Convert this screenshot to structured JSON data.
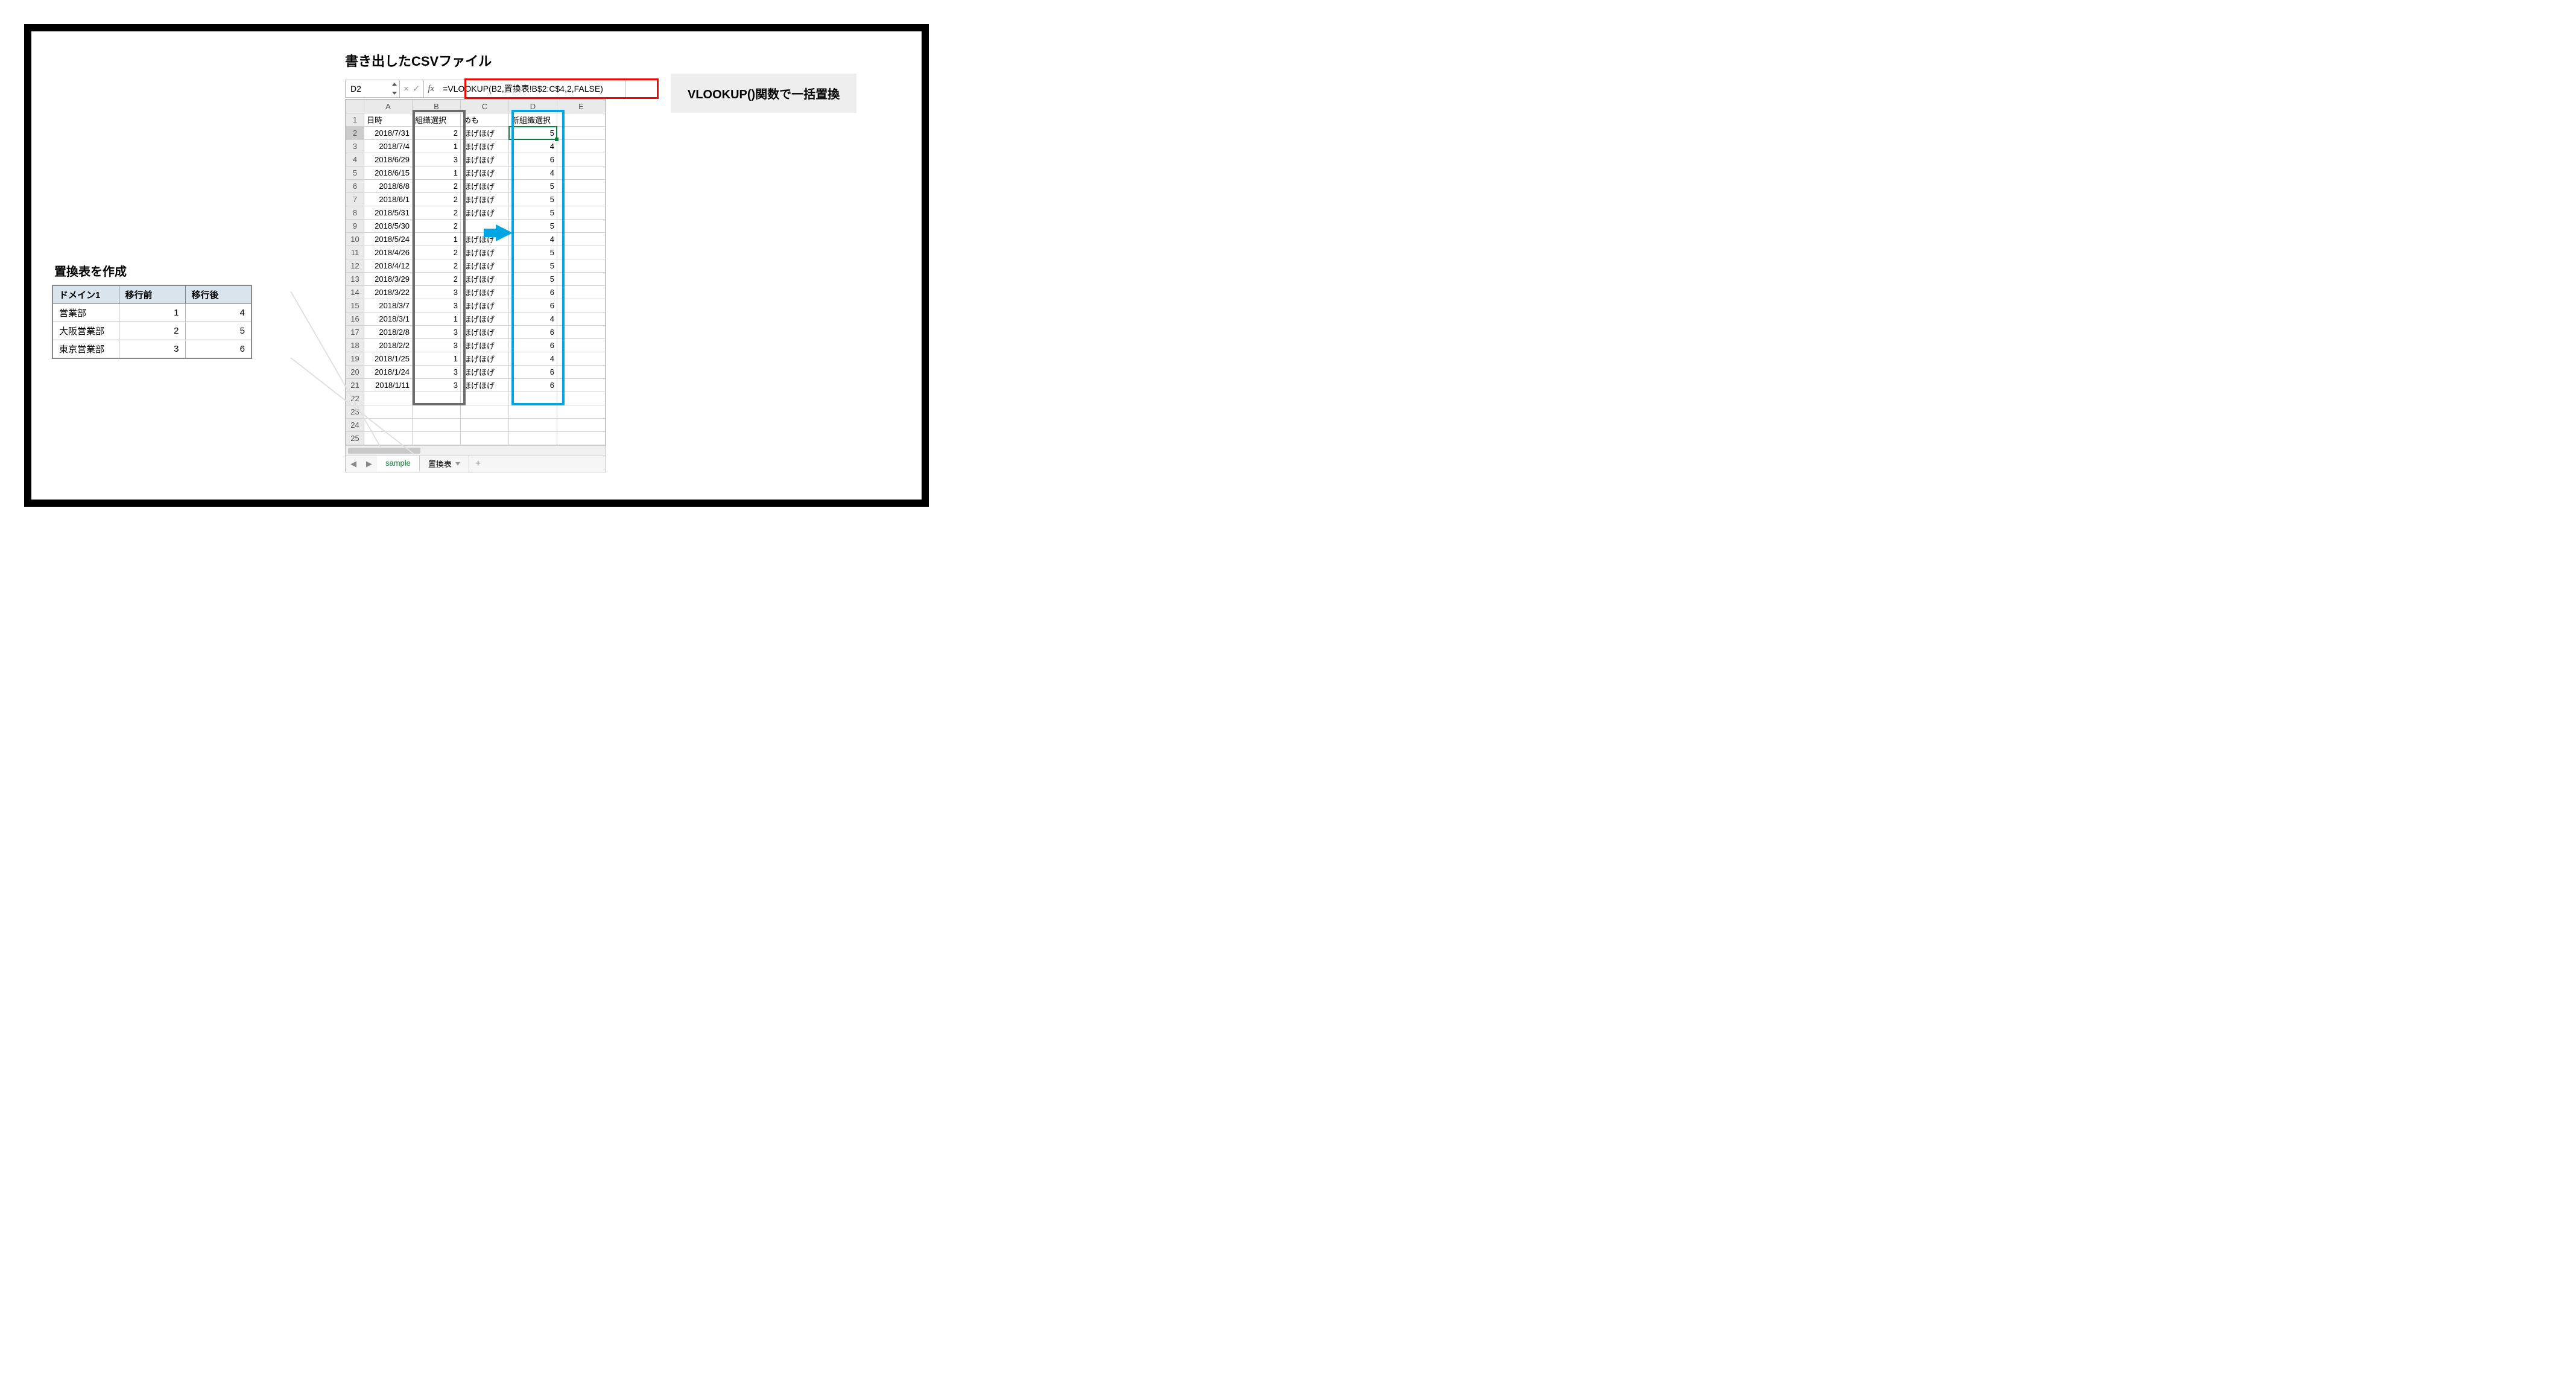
{
  "csv_title": "書き出したCSVファイル",
  "callout": "VLOOKUP()関数で一括置換",
  "map_title": "置換表を作成",
  "formula_bar": {
    "cell_ref": "D2",
    "cancel": "×",
    "confirm": "✓",
    "fx": "fx",
    "formula": "=VLOOKUP(B2,置換表!B$2:C$4,2,FALSE)"
  },
  "columns": [
    "A",
    "B",
    "C",
    "D",
    "E"
  ],
  "headers": {
    "A": "日時",
    "B": "組織選択",
    "C": "めも",
    "D": "新組織選択",
    "E": ""
  },
  "rows": [
    {
      "n": 2,
      "A": "2018/7/31",
      "B": "2",
      "C": "ほげほげ",
      "D": "5"
    },
    {
      "n": 3,
      "A": "2018/7/4",
      "B": "1",
      "C": "ほげほげ",
      "D": "4"
    },
    {
      "n": 4,
      "A": "2018/6/29",
      "B": "3",
      "C": "ほげほげ",
      "D": "6"
    },
    {
      "n": 5,
      "A": "2018/6/15",
      "B": "1",
      "C": "ほげほげ",
      "D": "4"
    },
    {
      "n": 6,
      "A": "2018/6/8",
      "B": "2",
      "C": "ほげほげ",
      "D": "5"
    },
    {
      "n": 7,
      "A": "2018/6/1",
      "B": "2",
      "C": "ほげほげ",
      "D": "5"
    },
    {
      "n": 8,
      "A": "2018/5/31",
      "B": "2",
      "C": "ほげほげ",
      "D": "5"
    },
    {
      "n": 9,
      "A": "2018/5/30",
      "B": "2",
      "C": "",
      "D": "5"
    },
    {
      "n": 10,
      "A": "2018/5/24",
      "B": "1",
      "C": "ほげほげ",
      "D": "4"
    },
    {
      "n": 11,
      "A": "2018/4/26",
      "B": "2",
      "C": "ほげほげ",
      "D": "5"
    },
    {
      "n": 12,
      "A": "2018/4/12",
      "B": "2",
      "C": "ほげほげ",
      "D": "5"
    },
    {
      "n": 13,
      "A": "2018/3/29",
      "B": "2",
      "C": "ほげほげ",
      "D": "5"
    },
    {
      "n": 14,
      "A": "2018/3/22",
      "B": "3",
      "C": "ほげほげ",
      "D": "6"
    },
    {
      "n": 15,
      "A": "2018/3/7",
      "B": "3",
      "C": "ほげほげ",
      "D": "6"
    },
    {
      "n": 16,
      "A": "2018/3/1",
      "B": "1",
      "C": "ほげほげ",
      "D": "4"
    },
    {
      "n": 17,
      "A": "2018/2/8",
      "B": "3",
      "C": "ほげほげ",
      "D": "6"
    },
    {
      "n": 18,
      "A": "2018/2/2",
      "B": "3",
      "C": "ほげほげ",
      "D": "6"
    },
    {
      "n": 19,
      "A": "2018/1/25",
      "B": "1",
      "C": "ほげほげ",
      "D": "4"
    },
    {
      "n": 20,
      "A": "2018/1/24",
      "B": "3",
      "C": "ほげほげ",
      "D": "6"
    },
    {
      "n": 21,
      "A": "2018/1/11",
      "B": "3",
      "C": "ほげほげ",
      "D": "6"
    }
  ],
  "empty_rows": [
    22,
    23,
    24,
    25
  ],
  "tabs": {
    "prev": "◀",
    "next": "▶",
    "active": "sample",
    "other": "置換表",
    "add": "+"
  },
  "map_headers": [
    "ドメイン1",
    "移行前",
    "移行後"
  ],
  "map_rows": [
    {
      "name": "営業部",
      "before": "1",
      "after": "4"
    },
    {
      "name": "大阪営業部",
      "before": "2",
      "after": "5"
    },
    {
      "name": "東京営業部",
      "before": "3",
      "after": "6"
    }
  ]
}
